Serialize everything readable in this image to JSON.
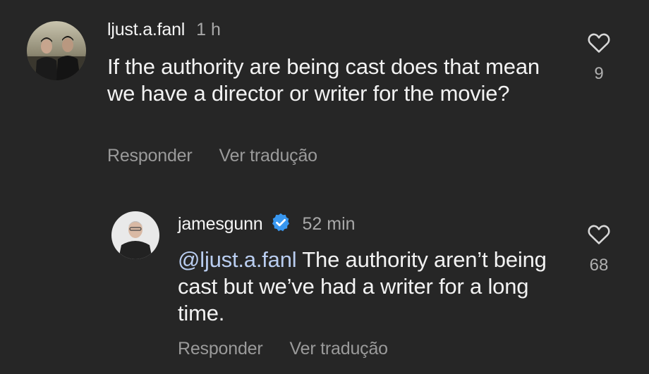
{
  "comment": {
    "username": "ljust.a.fanl",
    "time": "1 h",
    "text": "If the authority are being cast does that mean we have a director or writer for the movie?",
    "like_count": "9",
    "reply_label": "Responder",
    "translate_label": "Ver tradução",
    "avatar_icon": "avatar-photo-two-men",
    "like_icon": "heart-outline-icon"
  },
  "reply": {
    "username": "jamesgunn",
    "verified_icon": "verified-badge-icon",
    "verified_color": "#3897f0",
    "time": "52 min",
    "mention": "@ljust.a.fanl",
    "text": " The authority aren’t being cast but we’ve had a writer for a long time.",
    "like_count": "68",
    "reply_label": "Responder",
    "translate_label": "Ver tradução",
    "avatar_icon": "avatar-photo-man",
    "like_icon": "heart-outline-icon"
  }
}
